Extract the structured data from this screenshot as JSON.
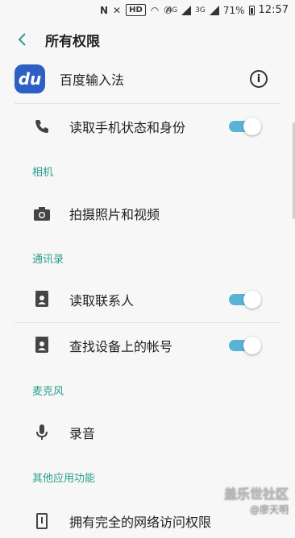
{
  "status_bar": {
    "hd_label": "HD",
    "network_1": "4G",
    "network_2": "3G",
    "battery": "71%",
    "time": "12:57"
  },
  "header": {
    "title": "所有权限"
  },
  "app": {
    "name": "百度输入法",
    "logo_text": "du"
  },
  "rows": {
    "phone": {
      "label": "读取手机状态和身份",
      "enabled": true
    },
    "camera": {
      "label": "拍摄照片和视频"
    },
    "contacts": {
      "label": "读取联系人",
      "enabled": true
    },
    "accounts": {
      "label": "查找设备上的帐号",
      "enabled": true
    },
    "mic": {
      "label": "录音"
    },
    "network": {
      "label": "拥有完全的网络访问权限"
    }
  },
  "sections": {
    "camera": "相机",
    "contacts": "通讯录",
    "mic": "麦克风",
    "other": "其他应用功能"
  },
  "watermark": {
    "line1": "盖乐世社区",
    "line2": "@廖天明"
  },
  "colors": {
    "accent": "#2a9d8f",
    "toggle_on": "#5bb2d7"
  }
}
